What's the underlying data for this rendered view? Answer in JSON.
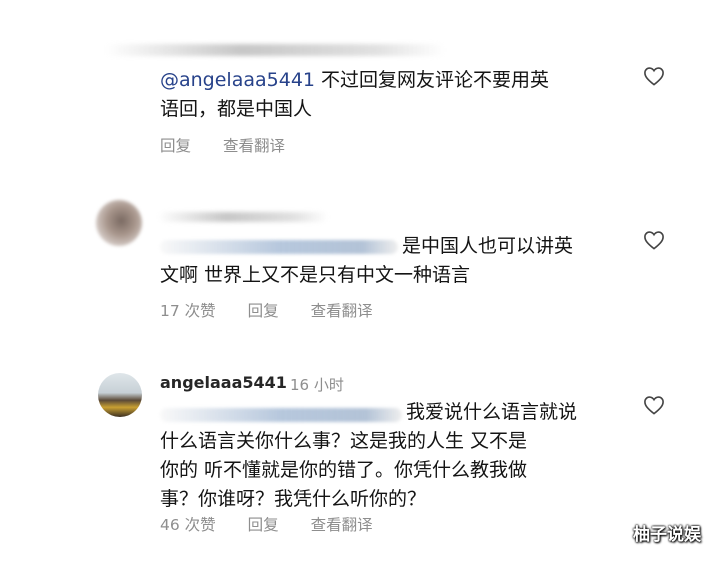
{
  "comments": [
    {
      "mention": "@angelaaa5441",
      "line1_rest": " 不过回复网友评论不要用英",
      "line2": "语回，都是中国人",
      "actions": {
        "reply": "回复",
        "translate": "查看翻译"
      }
    },
    {
      "line1_rest": "是中国人也可以讲英",
      "line2": "文啊 世界上又不是只有中文一种语言",
      "actions": {
        "likes": "17 次赞",
        "reply": "回复",
        "translate": "查看翻译"
      }
    },
    {
      "username": "angelaaa5441",
      "time": "16 小时",
      "line1_rest": "我爱说什么语言就说",
      "line2": "什么语言关你什么事？这是我的人生 又不是",
      "line3": "你的 听不懂就是你的错了。你凭什么教我做",
      "line4": "事？你谁呀？我凭什么听你的？",
      "actions": {
        "likes": "46 次赞",
        "reply": "回复",
        "translate": "查看翻译"
      }
    }
  ],
  "icons": {
    "like": "heart-icon"
  },
  "watermark": "柚子说娱"
}
